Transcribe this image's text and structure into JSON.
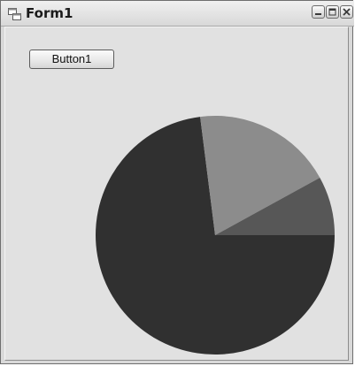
{
  "window": {
    "title": "Form1",
    "icon": "form-window-icon",
    "controls": [
      "minimize-icon",
      "maximize-icon",
      "close-icon"
    ]
  },
  "form": {
    "button_label": "Button1"
  },
  "chart_data": {
    "type": "pie",
    "values": [
      73,
      19,
      8
    ],
    "colors": [
      "#303030",
      "#8c8c8c",
      "#575757"
    ],
    "start_angle_deg": 0,
    "direction": "clockwise"
  }
}
